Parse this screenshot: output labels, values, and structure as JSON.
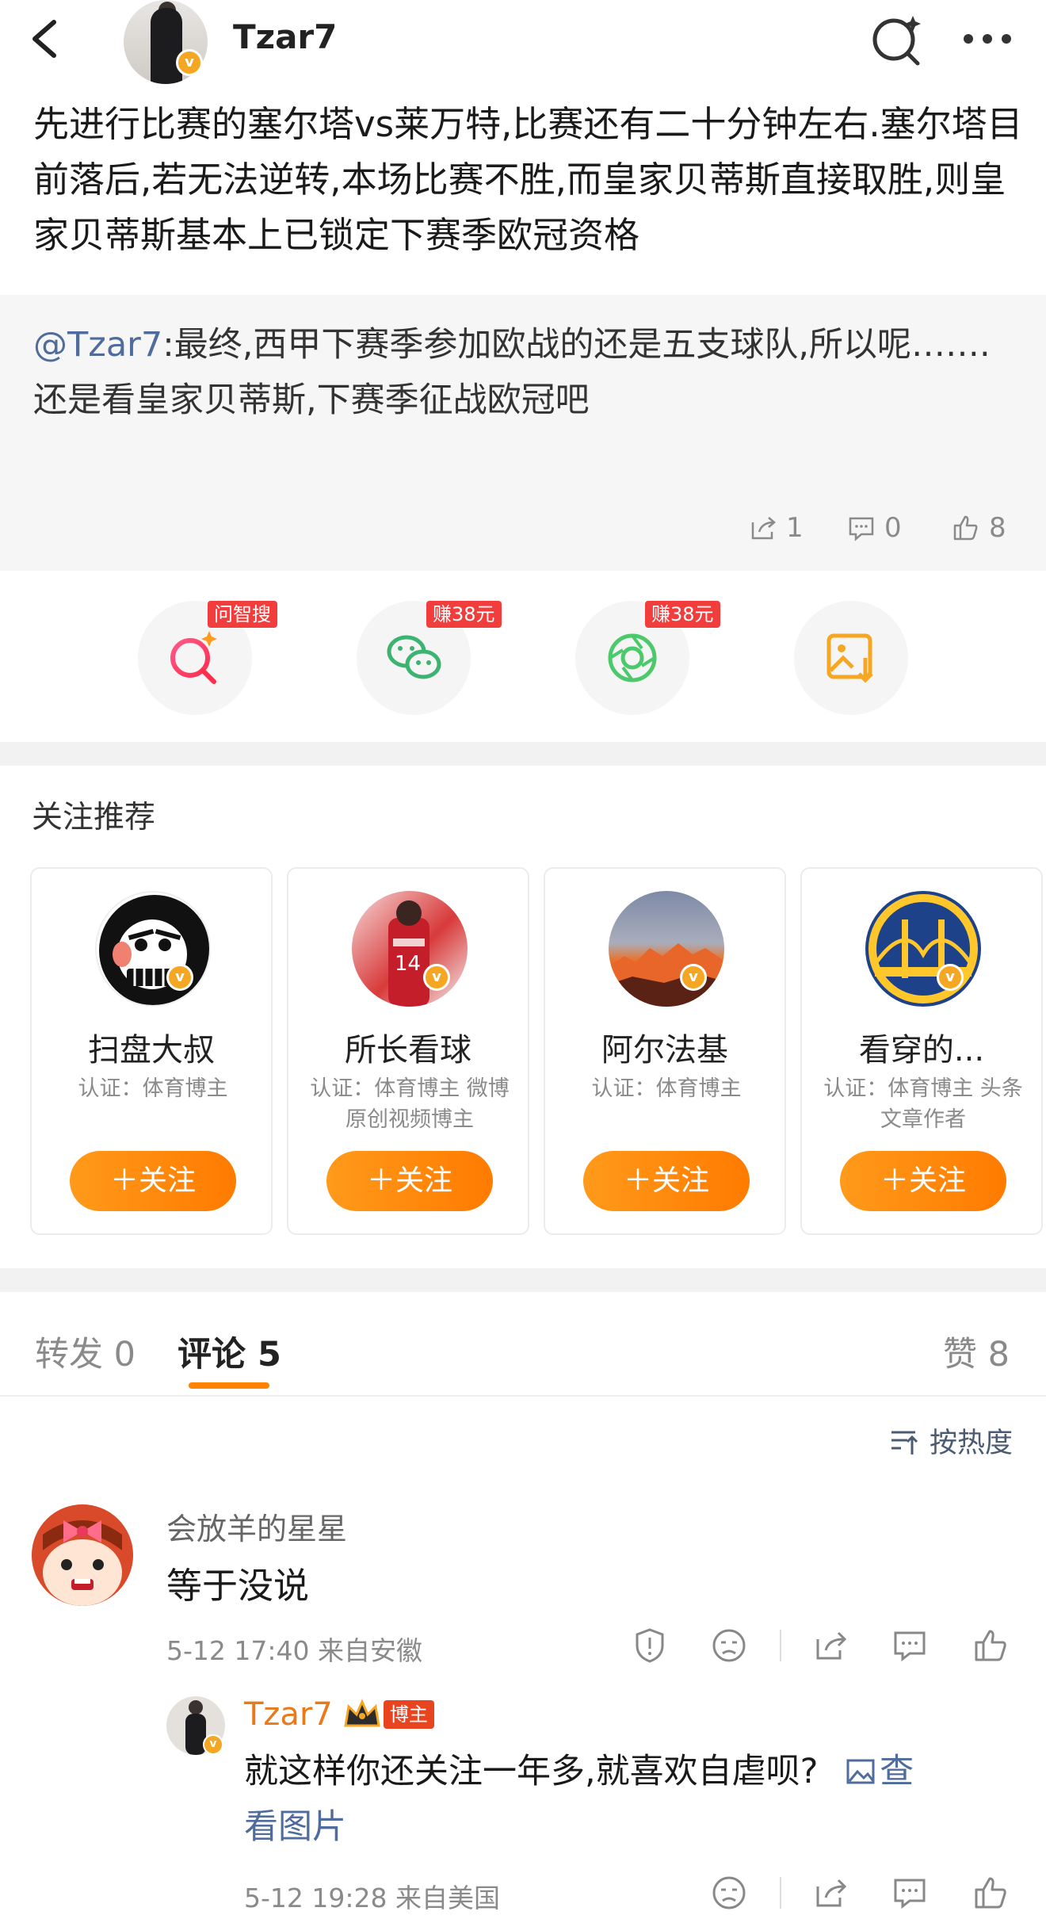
{
  "header": {
    "username": "Tzar7",
    "verified_badge": "v"
  },
  "post": {
    "text": "先进行比赛的塞尔塔vs莱万特,比赛还有二十分钟左右.塞尔塔目前落后,若无法逆转,本场比赛不胜,而皇家贝蒂斯直接取胜,则皇家贝蒂斯基本上已锁定下赛季欧冠资格"
  },
  "repost": {
    "mention": "@Tzar7",
    "line1": ":最终,西甲下赛季参加欧战的还是五支球队,所以呢…….",
    "line2": "还是看皇家贝蒂斯,下赛季征战欧冠吧",
    "stats": {
      "reposts": "1",
      "comments": "0",
      "likes": "8"
    }
  },
  "share": {
    "tags": [
      "问智搜",
      "赚38元",
      "赚38元"
    ],
    "icons": [
      "ai-search-icon",
      "wechat-icon",
      "moments-icon",
      "save-image-icon"
    ]
  },
  "recommend": {
    "title": "关注推荐",
    "follow_label": "＋关注",
    "cards": [
      {
        "name": "扫盘大叔",
        "desc": "认证：体育博主"
      },
      {
        "name": "所长看球",
        "desc": "认证：体育博主 微博原创视频博主"
      },
      {
        "name": "阿尔法基",
        "desc": "认证：体育博主"
      },
      {
        "name": "看穿的...",
        "desc": "认证：体育博主 头条文章作者"
      }
    ]
  },
  "tabs": {
    "repost_label": "转发",
    "repost_count": "0",
    "comment_label": "评论",
    "comment_count": "5",
    "like_label": "赞",
    "like_count": "8"
  },
  "sort_label": "按热度",
  "comment": {
    "user": "会放羊的星星",
    "text": "等于没说",
    "time": "5-12 17:40",
    "location": "来自安徽"
  },
  "reply": {
    "user": "Tzar7",
    "badge": "博主",
    "text": "就这样你还关注一年多,就喜欢自虐呗?",
    "link_line1": "查",
    "link_line2": "看图片",
    "time": "5-12 19:28",
    "location": "来自美国"
  },
  "colors": {
    "accent": "#ff8200",
    "link": "#4f6c9c",
    "badge": "#f5a623"
  }
}
